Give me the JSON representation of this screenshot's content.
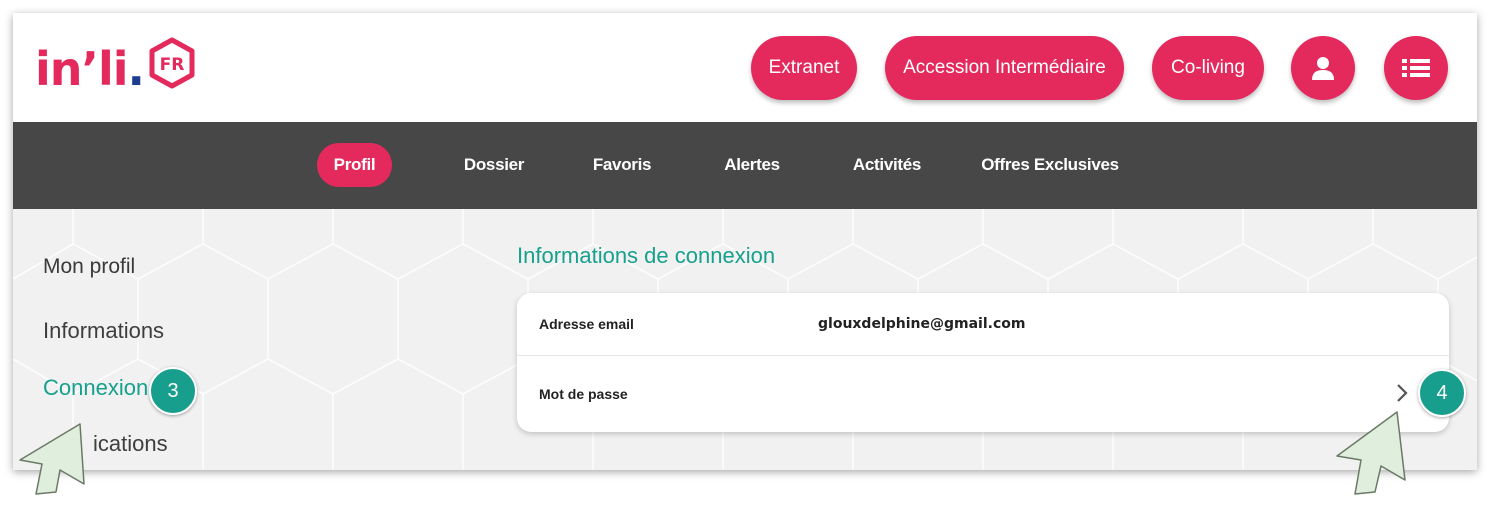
{
  "logo": {
    "text_main": "in’li",
    "text_dot": ".",
    "badge": "FR"
  },
  "header": {
    "buttons": [
      {
        "label": "Extranet"
      },
      {
        "label": "Accession Intermédiaire"
      },
      {
        "label": "Co-living"
      }
    ],
    "icons": {
      "account": "user-icon",
      "menu": "menu-list-icon"
    }
  },
  "nav": {
    "items": [
      {
        "label": "Profil",
        "active": true
      },
      {
        "label": "Dossier"
      },
      {
        "label": "Favoris"
      },
      {
        "label": "Alertes"
      },
      {
        "label": "Activités"
      },
      {
        "label": "Offres Exclusives"
      }
    ]
  },
  "sidebar": {
    "title": "Mon profil",
    "items": [
      {
        "label": "Informations"
      },
      {
        "label": "Connexion",
        "active": true
      },
      {
        "label": "Notifications",
        "visible_fragment": "ications"
      }
    ]
  },
  "main": {
    "section_title": "Informations de connexion",
    "rows": [
      {
        "label": "Adresse email",
        "value": "glouxdelphine@gmail.com"
      },
      {
        "label": "Mot de passe",
        "value": ""
      }
    ]
  },
  "annotations": {
    "step_a": "3",
    "step_b": "4"
  },
  "colors": {
    "brand_pink": "#e42a5d",
    "accent_teal": "#17a08d",
    "nav_bg": "#474747",
    "content_bg": "#f1f1f1",
    "logo_dot": "#1d3d8f",
    "cursor_fill": "#dfeedd"
  }
}
